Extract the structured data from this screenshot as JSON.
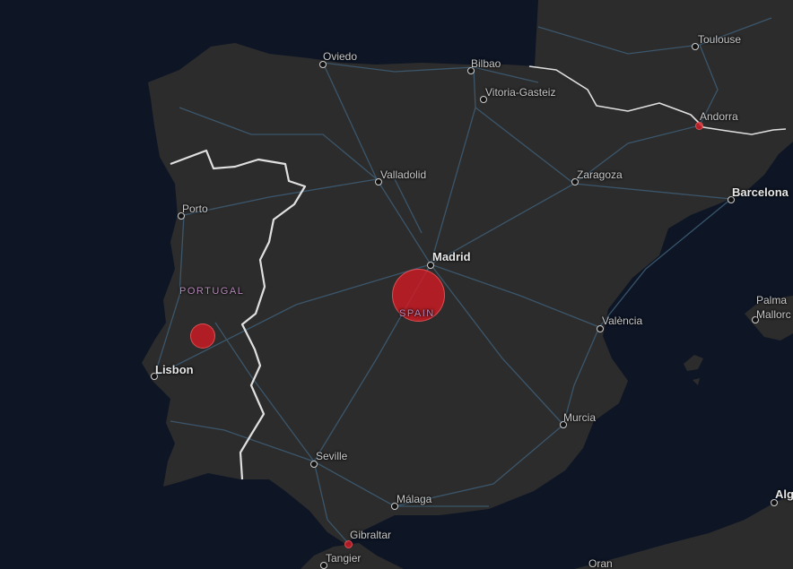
{
  "colors": {
    "sea": "#0e1626",
    "land": "#2c2c2c",
    "roads": "#3d5b72",
    "border": "#e0e0e0",
    "bubble": "#d61a22"
  },
  "countries": {
    "portugal": "PORTUGAL",
    "spain": "SPAIN"
  },
  "cities": {
    "oviedo": "Oviedo",
    "bilbao": "Bilbao",
    "vitoria": "Vitoria-Gasteiz",
    "toulouse": "Toulouse",
    "andorra": "Andorra",
    "valladolid": "Valladolid",
    "zaragoza": "Zaragoza",
    "barcelona": "Barcelona",
    "porto": "Porto",
    "madrid": "Madrid",
    "palma": "Palma",
    "mallorca": "Mallorc",
    "valencia": "València",
    "lisbon": "Lisbon",
    "murcia": "Murcia",
    "seville": "Seville",
    "malaga": "Málaga",
    "gibraltar": "Gibraltar",
    "tangier": "Tangier",
    "oran": "Oran",
    "algiers": "Alg"
  },
  "bubbles": [
    {
      "place": "Madrid region",
      "relative_size": "large"
    },
    {
      "place": "Portugal (central)",
      "relative_size": "medium"
    },
    {
      "place": "Andorra",
      "relative_size": "small"
    },
    {
      "place": "Gibraltar",
      "relative_size": "small"
    }
  ]
}
